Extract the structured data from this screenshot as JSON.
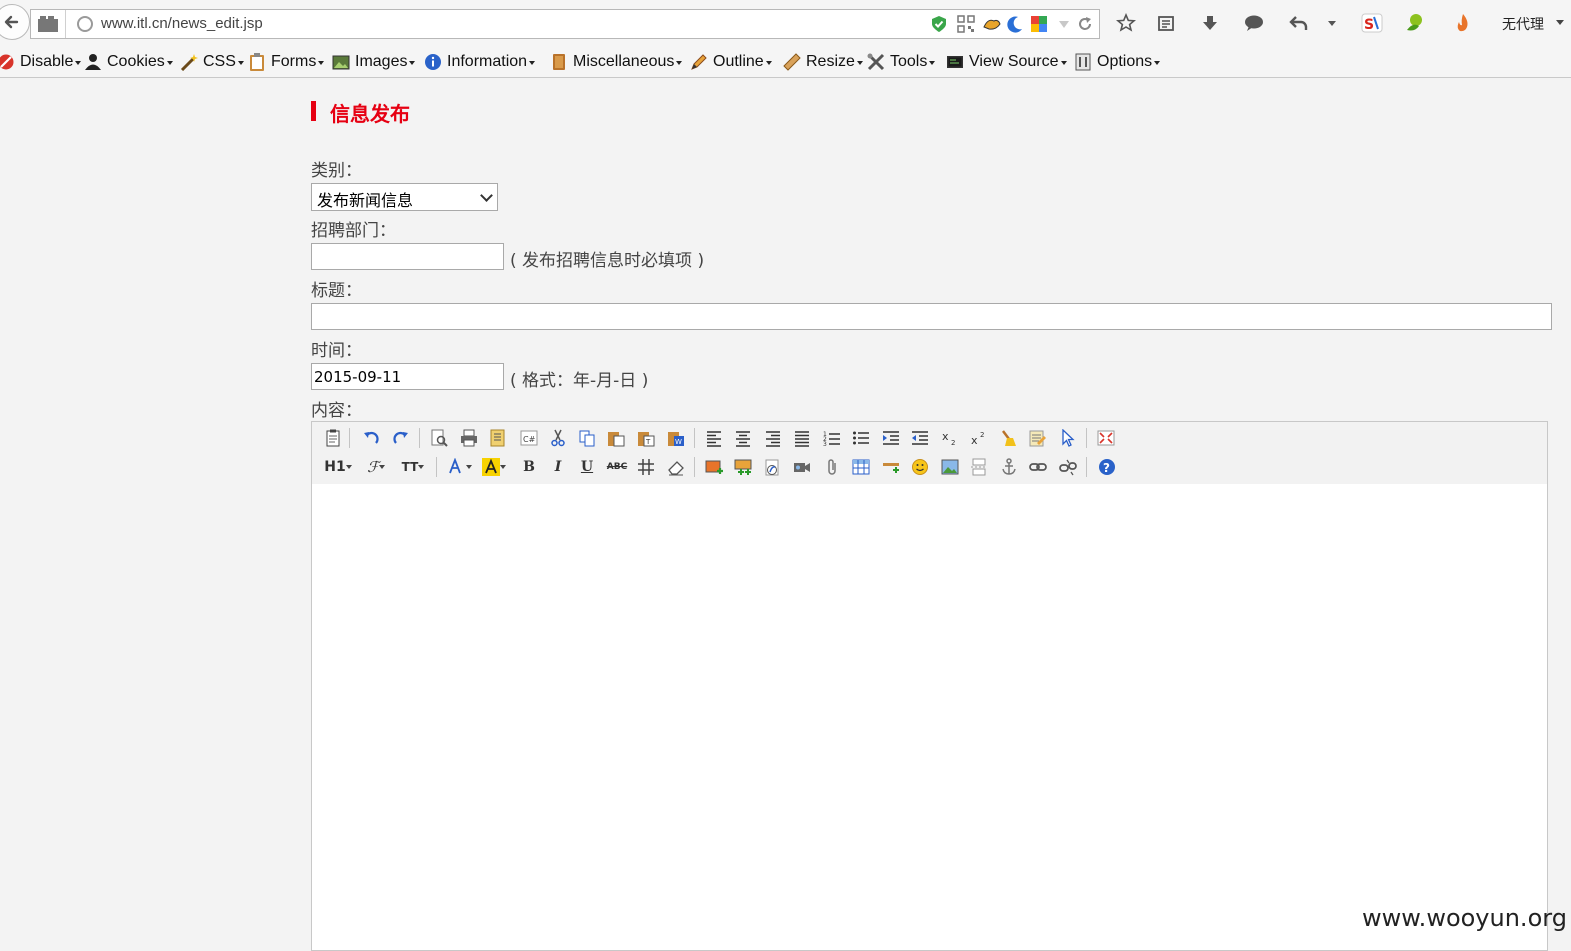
{
  "browser": {
    "url": "www.itl.cn/news_edit.jsp",
    "proxy_label": "无代理"
  },
  "webdev_toolbar": {
    "items": [
      {
        "label": "Disable",
        "icon": "disable-icon"
      },
      {
        "label": "Cookies",
        "icon": "cookies-icon"
      },
      {
        "label": "CSS",
        "icon": "css-wand-icon"
      },
      {
        "label": "Forms",
        "icon": "forms-clipboard-icon"
      },
      {
        "label": "Images",
        "icon": "images-icon"
      },
      {
        "label": "Information",
        "icon": "information-icon"
      },
      {
        "label": "Miscellaneous",
        "icon": "miscellaneous-book-icon"
      },
      {
        "label": "Outline",
        "icon": "outline-pencil-icon"
      },
      {
        "label": "Resize",
        "icon": "resize-ruler-icon"
      },
      {
        "label": "Tools",
        "icon": "tools-icon"
      },
      {
        "label": "View Source",
        "icon": "view-source-icon"
      },
      {
        "label": "Options",
        "icon": "options-icon"
      }
    ]
  },
  "page": {
    "title": "信息发布",
    "category_label": "类别：",
    "category_value": "发布新闻信息",
    "department_label": "招聘部门：",
    "department_value": "",
    "department_hint": "( 发布招聘信息时必填项 )",
    "headline_label": "标题：",
    "headline_value": "",
    "time_label": "时间：",
    "time_value": "2015-09-11",
    "time_hint": "( 格式：年-月-日 )",
    "content_label": "内容："
  },
  "editor": {
    "heading_button": "H1",
    "font_size_button": "TT",
    "strike_button": "ABC"
  },
  "watermark": "www.wooyun.org",
  "colors": {
    "accent_red": "#e60012",
    "page_bg": "#f3f3f3"
  }
}
